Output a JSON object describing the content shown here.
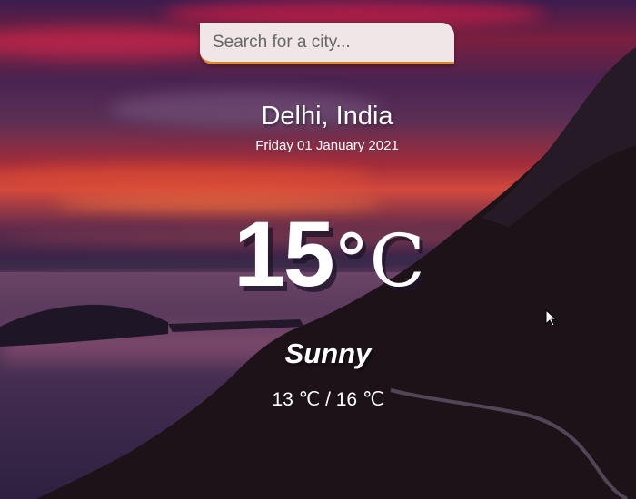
{
  "search": {
    "placeholder": "Search for a city...",
    "value": ""
  },
  "weather": {
    "location": "Delhi, India",
    "date": "Friday 01 January 2021",
    "temperature": "15",
    "temperature_unit": "°C",
    "condition": "Sunny",
    "range": "13 ℃ / 16 ℃"
  },
  "colors": {
    "search_accent": "#d9892f",
    "search_bg": "#f0e6e7",
    "text": "#ffffff"
  },
  "icons": {
    "cursor": "mouse-pointer-icon"
  }
}
